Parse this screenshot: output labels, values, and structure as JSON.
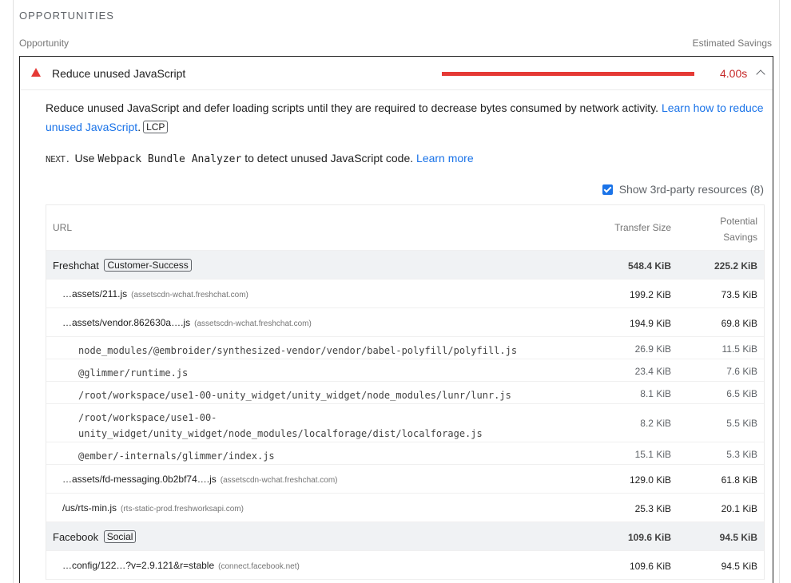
{
  "section": {
    "title": "OPPORTUNITIES",
    "col_left": "Opportunity",
    "col_right": "Estimated Savings"
  },
  "audit": {
    "title": "Reduce unused JavaScript",
    "savings": "4.00s",
    "description": "Reduce unused JavaScript and defer loading scripts until they are required to decrease bytes consumed by network activity. ",
    "learn_link": "Learn how to reduce unused JavaScript",
    "badge": "LCP",
    "next_logo": "NEXT.",
    "next_pre": "Use ",
    "next_code": "Webpack Bundle Analyzer",
    "next_post": " to detect unused JavaScript code. ",
    "next_link": "Learn more",
    "third_party_label": "Show 3rd-party resources (8)",
    "colors": {
      "fail": "#e53935",
      "link": "#1a73e8"
    }
  },
  "table": {
    "headers": {
      "url": "URL",
      "transfer": "Transfer Size",
      "savings_1": "Potential",
      "savings_2": "Savings"
    },
    "groups": [
      {
        "name": "Freshchat",
        "tag": "Customer-Success",
        "size": "548.4 KiB",
        "savings": "225.2 KiB",
        "items": [
          {
            "url": "…assets/211.js",
            "origin": "(assetscdn-wchat.freshchat.com)",
            "size": "199.2 KiB",
            "savings": "73.5 KiB"
          },
          {
            "url": "…assets/vendor.862630a….js",
            "origin": "(assetscdn-wchat.freshchat.com)",
            "size": "194.9 KiB",
            "savings": "69.8 KiB",
            "subs": [
              {
                "url": "node_modules/@embroider/synthesized-vendor/vendor/babel-polyfill/polyfill.js",
                "size": "26.9 KiB",
                "savings": "11.5 KiB"
              },
              {
                "url": "@glimmer/runtime.js",
                "size": "23.4 KiB",
                "savings": "7.6 KiB"
              },
              {
                "url": "/root/workspace/use1-00-unity_widget/unity_widget/node_modules/lunr/lunr.js",
                "size": "8.1 KiB",
                "savings": "6.5 KiB"
              },
              {
                "url_1": "/root/workspace/use1-00-",
                "url_2": "unity_widget/unity_widget/node_modules/localforage/dist/localforage.js",
                "size": "8.2 KiB",
                "savings": "5.5 KiB"
              },
              {
                "url": "@ember/-internals/glimmer/index.js",
                "size": "15.1 KiB",
                "savings": "5.3 KiB"
              }
            ]
          },
          {
            "url": "…assets/fd-messaging.0b2bf74….js",
            "origin": "(assetscdn-wchat.freshchat.com)",
            "size": "129.0 KiB",
            "savings": "61.8 KiB"
          },
          {
            "url": "/us/rts-min.js",
            "origin": "(rts-static-prod.freshworksapi.com)",
            "size": "25.3 KiB",
            "savings": "20.1 KiB"
          }
        ]
      },
      {
        "name": "Facebook",
        "tag": "Social",
        "size": "109.6 KiB",
        "savings": "94.5 KiB",
        "items": [
          {
            "url": "…config/122…?v=2.9.121&r=stable",
            "origin": "(connect.facebook.net)",
            "size": "109.6 KiB",
            "savings": "94.5 KiB"
          }
        ]
      }
    ]
  }
}
